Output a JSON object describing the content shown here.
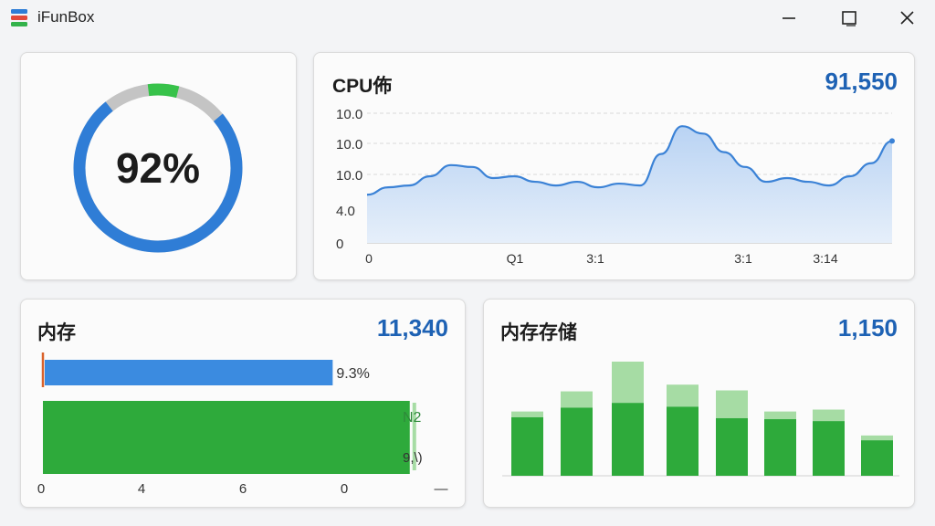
{
  "window": {
    "title": "iFunBox",
    "buttons": {
      "minimize": "minimize-icon",
      "maximize": "maximize-icon",
      "close": "close-icon"
    }
  },
  "colors": {
    "accent_blue": "#2f7dd6",
    "value_blue": "#1e62b4",
    "green": "#2eaa3b",
    "light_green": "#a6dca4",
    "ring_gray": "#c4c4c4",
    "area_blue": "#cfe0f6"
  },
  "gauge": {
    "label": "92%",
    "percent": 92
  },
  "cpu": {
    "title": "CPU佈",
    "value": "91,550",
    "chart_data": {
      "type": "area",
      "y_tick_labels": [
        "10.0",
        "10.0",
        "10.0",
        "4.0",
        "0"
      ],
      "x_tick_labels": [
        "0",
        "Q1",
        "3:1",
        "3:1",
        "3:14"
      ],
      "series": [
        {
          "values": [
            2.6,
            3.0,
            3.1,
            3.6,
            4.2,
            4.1,
            3.5,
            3.6,
            3.3,
            3.1,
            3.3,
            3.0,
            3.2,
            3.1,
            4.8,
            6.3,
            5.9,
            4.9,
            4.1,
            3.3,
            3.5,
            3.3,
            3.1,
            3.6,
            4.3,
            5.5
          ]
        }
      ]
    }
  },
  "memory": {
    "title": "内存",
    "value": "11,340",
    "chart_data": {
      "type": "bar",
      "orientation": "horizontal",
      "bar_labels": [
        "9.3%",
        "N2",
        "9,\\)"
      ],
      "x_tick_labels": [
        "0",
        "4",
        "6",
        "0",
        "—"
      ],
      "bars": [
        {
          "value": 0.73,
          "color": "#3b8be0"
        },
        {
          "value": 0.93,
          "color": "#2eaa3b"
        }
      ]
    }
  },
  "storage": {
    "title": "内存存储",
    "value": "1,150",
    "chart_data": {
      "type": "bar",
      "stacked": true,
      "series": [
        {
          "color": "#2eaa3b",
          "values": [
            61,
            71,
            76,
            72,
            60,
            59,
            57,
            37
          ]
        },
        {
          "color": "#a6dca4",
          "values": [
            6,
            17,
            43,
            23,
            29,
            8,
            12,
            5
          ]
        }
      ]
    }
  }
}
